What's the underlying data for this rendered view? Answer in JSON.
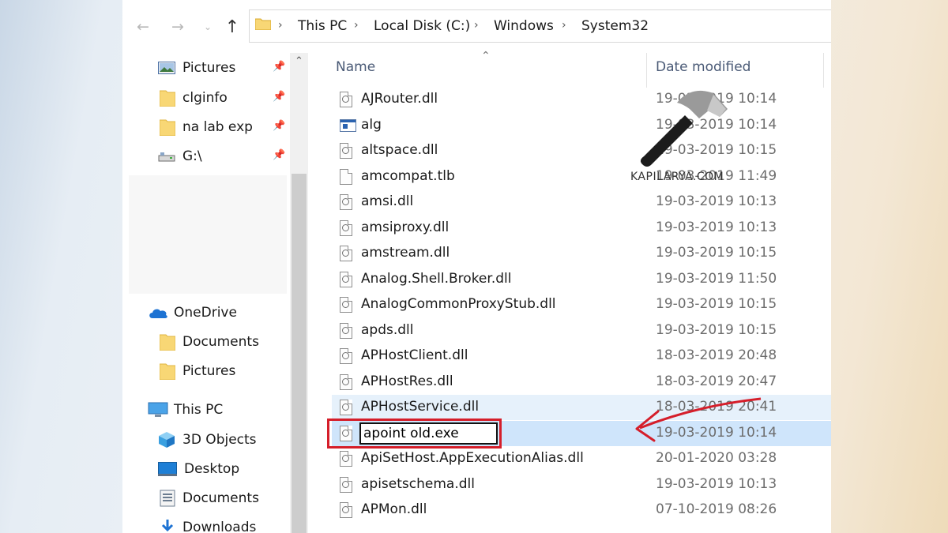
{
  "breadcrumb": [
    "This PC",
    "Local Disk (C:)",
    "Windows",
    "System32"
  ],
  "navigation": {
    "back_icon": "back-arrow-icon",
    "forward_icon": "forward-arrow-icon",
    "up_icon": "up-arrow-icon"
  },
  "sidebar": {
    "quick_access": [
      {
        "label": "Pictures",
        "icon": "pictures-icon",
        "pinned": true
      },
      {
        "label": "clginfo",
        "icon": "folder-icon",
        "pinned": true
      },
      {
        "label": "na lab exp",
        "icon": "folder-icon",
        "pinned": true
      },
      {
        "label": "G:\\",
        "icon": "drive-icon",
        "pinned": true
      }
    ],
    "onedrive": {
      "label": "OneDrive",
      "icon": "cloud-icon",
      "children": [
        "Documents",
        "Pictures"
      ]
    },
    "this_pc": {
      "label": "This PC",
      "icon": "computer-icon",
      "children": [
        {
          "label": "3D Objects",
          "icon": "cube-icon"
        },
        {
          "label": "Desktop",
          "icon": "desktop-icon"
        },
        {
          "label": "Documents",
          "icon": "documents-icon"
        },
        {
          "label": "Downloads",
          "icon": "downloads-icon"
        }
      ]
    }
  },
  "filelist": {
    "columns": {
      "name": "Name",
      "date_modified": "Date modified"
    },
    "files": [
      {
        "name": "AJRouter.dll",
        "date": "19-03-2019 10:14",
        "type": "dll"
      },
      {
        "name": "alg",
        "date": "19-03-2019 10:14",
        "type": "exe"
      },
      {
        "name": "altspace.dll",
        "date": "19-03-2019 10:15",
        "type": "dll"
      },
      {
        "name": "amcompat.tlb",
        "date": "19-03-2019 11:49",
        "type": "blank"
      },
      {
        "name": "amsi.dll",
        "date": "19-03-2019 10:13",
        "type": "dll"
      },
      {
        "name": "amsiproxy.dll",
        "date": "19-03-2019 10:13",
        "type": "dll"
      },
      {
        "name": "amstream.dll",
        "date": "19-03-2019 10:15",
        "type": "dll"
      },
      {
        "name": "Analog.Shell.Broker.dll",
        "date": "19-03-2019 11:50",
        "type": "dll"
      },
      {
        "name": "AnalogCommonProxyStub.dll",
        "date": "19-03-2019 10:15",
        "type": "dll"
      },
      {
        "name": "apds.dll",
        "date": "19-03-2019 10:15",
        "type": "dll"
      },
      {
        "name": "APHostClient.dll",
        "date": "18-03-2019 20:48",
        "type": "dll"
      },
      {
        "name": "APHostRes.dll",
        "date": "18-03-2019 20:47",
        "type": "dll"
      },
      {
        "name": "APHostService.dll",
        "date": "18-03-2019 20:41",
        "type": "dll",
        "state": "hover"
      },
      {
        "name": "apoint old.exe",
        "date": "19-03-2019 10:14",
        "type": "dll",
        "state": "renaming"
      },
      {
        "name": "ApiSetHost.AppExecutionAlias.dll",
        "date": "20-01-2020 03:28",
        "type": "dll"
      },
      {
        "name": "apisetschema.dll",
        "date": "19-03-2019 10:13",
        "type": "dll"
      },
      {
        "name": "APMon.dll",
        "date": "07-10-2019 08:26",
        "type": "dll"
      }
    ]
  },
  "watermark": {
    "text": "KAPILARYA.COM",
    "icon": "hammer-icon"
  },
  "colors": {
    "accent_red": "#d51e2a",
    "selection": "#cfe5fb",
    "hover": "#e6f1fb",
    "folder": "#f8d775"
  }
}
